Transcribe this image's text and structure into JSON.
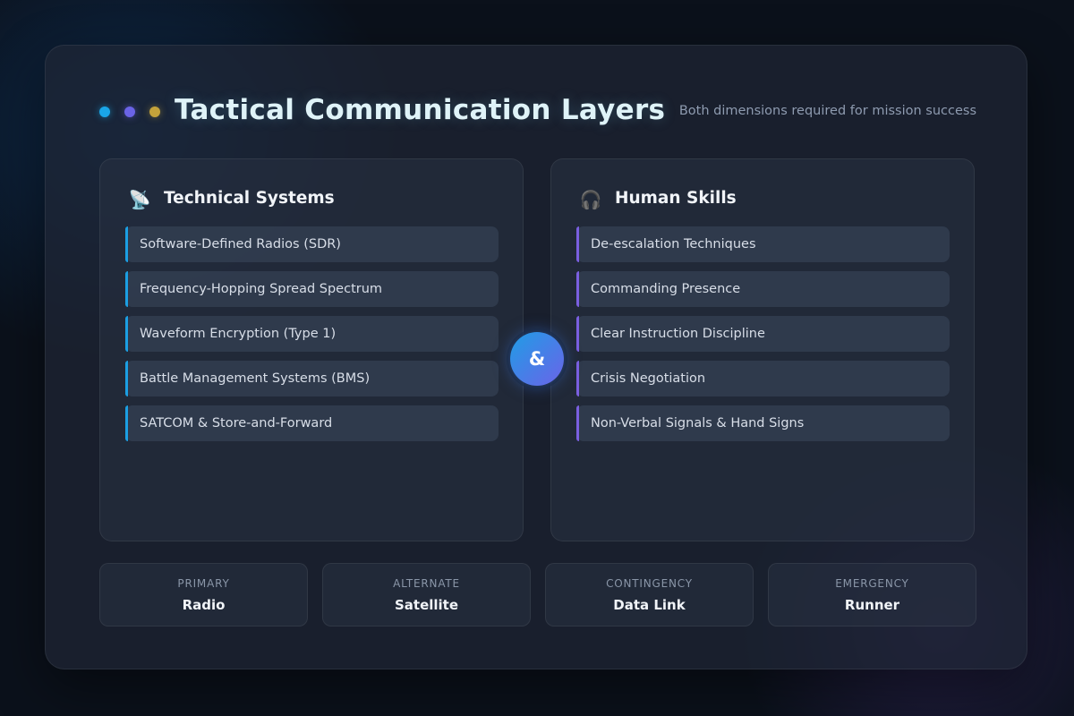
{
  "header": {
    "title": "Tactical Communication Layers",
    "subtitle": "Both dimensions required for mission success"
  },
  "panels": {
    "technical": {
      "icon": "satellite-dish-icon",
      "icon_glyph": "📡",
      "title": "Technical Systems",
      "accent": "#1b9fe3",
      "items": [
        "Software-Defined Radios (SDR)",
        "Frequency-Hopping Spread Spectrum",
        "Waveform Encryption (Type 1)",
        "Battle Management Systems (BMS)",
        "SATCOM & Store-and-Forward"
      ]
    },
    "human": {
      "icon": "headphones-icon",
      "icon_glyph": "🎧",
      "title": "Human Skills",
      "accent": "#7a5fe0",
      "items": [
        "De-escalation Techniques",
        "Commanding Presence",
        "Clear Instruction Discipline",
        "Crisis Negotiation",
        "Non-Verbal Signals & Hand Signs"
      ]
    }
  },
  "connector": {
    "label": "&"
  },
  "channels": [
    {
      "label": "PRIMARY",
      "value": "Radio"
    },
    {
      "label": "ALTERNATE",
      "value": "Satellite"
    },
    {
      "label": "CONTINGENCY",
      "value": "Data Link"
    },
    {
      "label": "EMERGENCY",
      "value": "Runner"
    }
  ],
  "colors": {
    "dot_1": "#1aa6e8",
    "dot_2": "#6a63e6",
    "dot_3": "#c4a33b",
    "connector_gradient_start": "#1f9de6",
    "connector_gradient_end": "#6b63e8"
  }
}
